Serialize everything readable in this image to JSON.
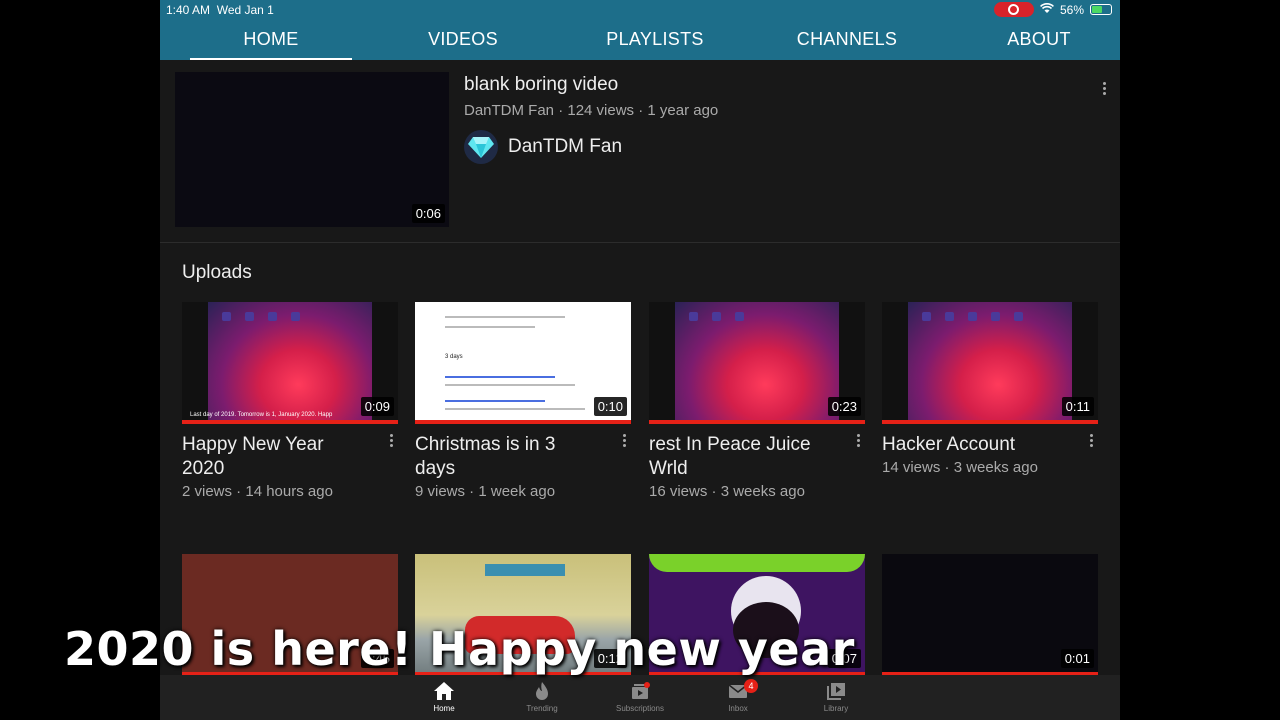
{
  "status_bar": {
    "time": "1:40 AM",
    "date": "Wed Jan 1",
    "battery": "56%",
    "battery_level": 0.56
  },
  "tabs": [
    {
      "label": "HOME",
      "active": true
    },
    {
      "label": "VIDEOS",
      "active": false
    },
    {
      "label": "PLAYLISTS",
      "active": false
    },
    {
      "label": "CHANNELS",
      "active": false
    },
    {
      "label": "ABOUT",
      "active": false
    }
  ],
  "featured": {
    "title": "blank boring video",
    "meta": "DanTDM Fan · 124 views · 1 year ago",
    "duration": "0:06",
    "channel_name": "DanTDM Fan",
    "channel_icon": "diamond-icon"
  },
  "uploads": {
    "section_title": "Uploads",
    "videos": [
      {
        "title": "Happy New Year 2020",
        "meta": "2 views · 14 hours ago",
        "duration": "0:09",
        "thumb_caption": "Last day of 2019. Tomorrow is 1, January 2020. Happ"
      },
      {
        "title": "Christmas is in 3 days",
        "meta": "9 views · 1 week ago",
        "duration": "0:10",
        "thumb_caption": "3 days"
      },
      {
        "title": "rest In Peace Juice Wrld",
        "meta": "16 views · 3 weeks ago",
        "duration": "0:23"
      },
      {
        "title": "Hacker Account",
        "meta": "14 views · 3 weeks ago",
        "duration": "0:11"
      }
    ],
    "row2": [
      {
        "duration": "0:45"
      },
      {
        "duration": "0:12"
      },
      {
        "duration": "0:07"
      },
      {
        "duration": "0:01"
      }
    ]
  },
  "overlay_caption": "2020 is here! Happy new year",
  "bottom_nav": [
    {
      "label": "Home",
      "icon": "home-icon",
      "active": true
    },
    {
      "label": "Trending",
      "icon": "flame-icon",
      "active": false
    },
    {
      "label": "Subscriptions",
      "icon": "subscriptions-icon",
      "active": false
    },
    {
      "label": "Inbox",
      "icon": "mail-icon",
      "active": false,
      "badge": "4"
    },
    {
      "label": "Library",
      "icon": "library-icon",
      "active": false
    }
  ],
  "colors": {
    "header": "#1d6e8a",
    "background": "#181818",
    "progress": "#e62117"
  }
}
